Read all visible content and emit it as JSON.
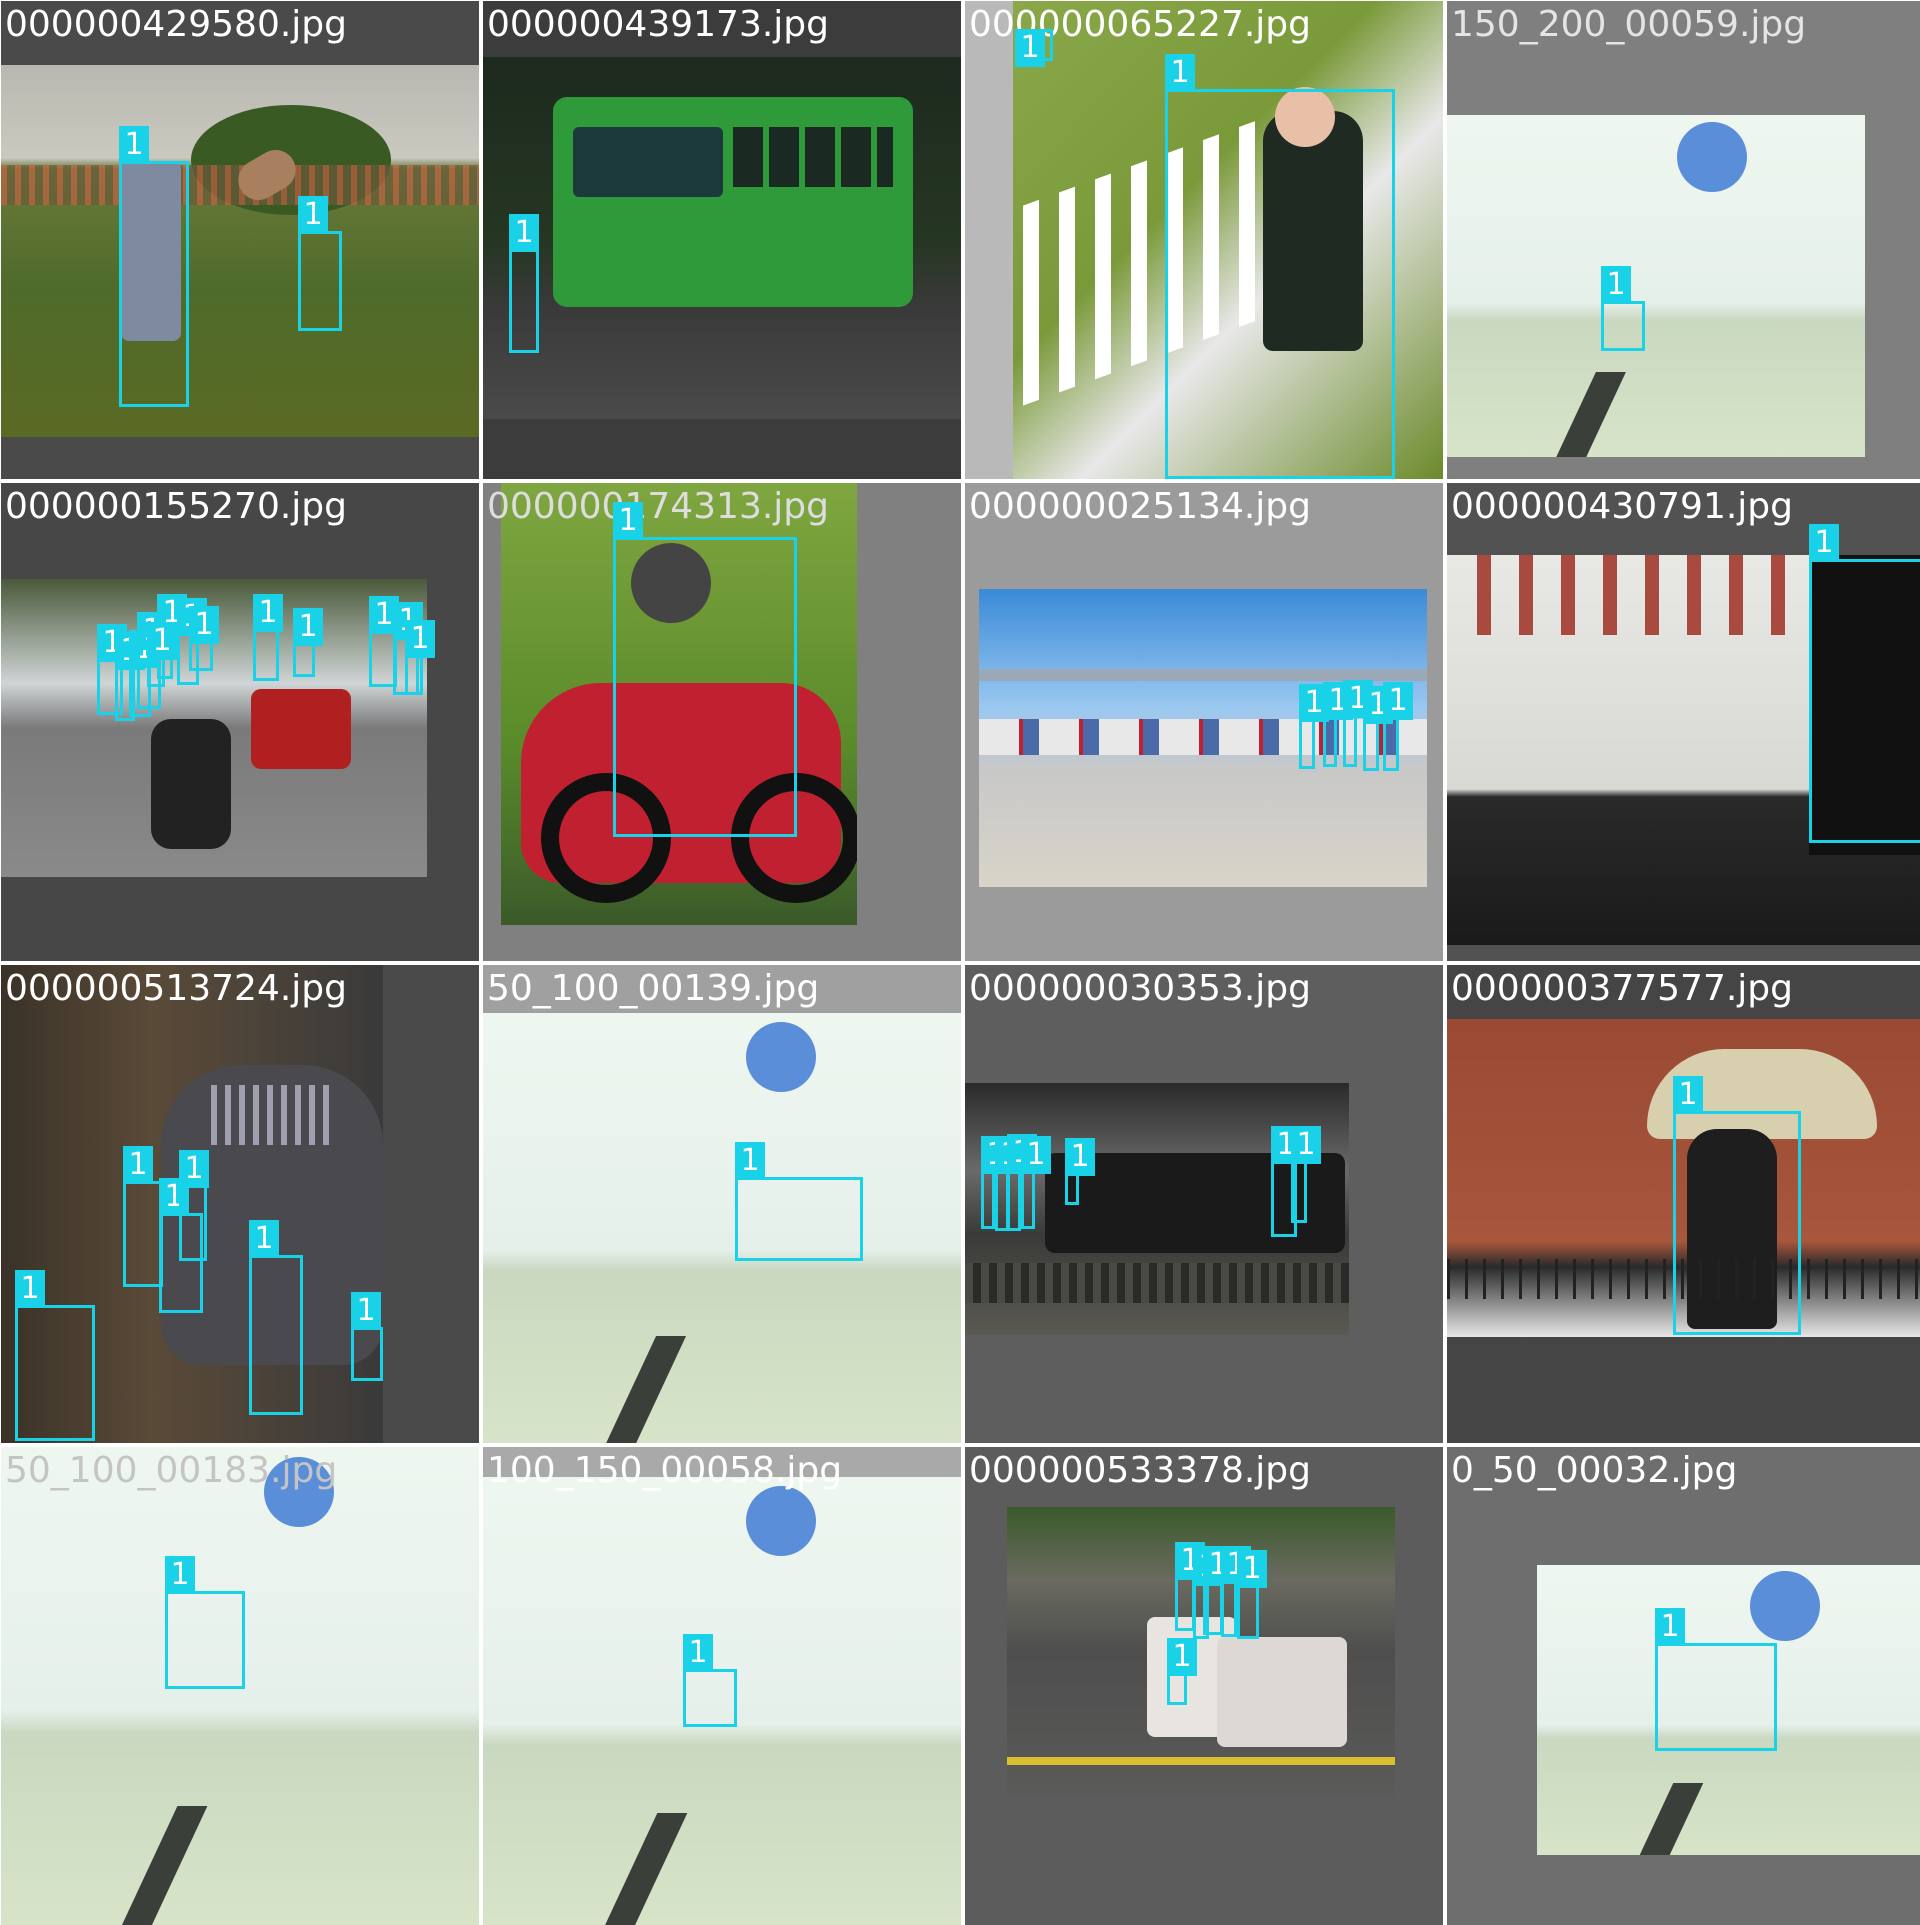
{
  "box_color": "#19d2e8",
  "label_text_color": "#ffffff",
  "images": [
    {
      "file": "000000429580.jpg",
      "boxes": [
        {
          "label": "1"
        },
        {
          "label": "1"
        }
      ]
    },
    {
      "file": "000000439173.jpg",
      "boxes": [
        {
          "label": "1"
        }
      ]
    },
    {
      "file": "000000065227.jpg",
      "boxes": [
        {
          "label": "1"
        },
        {
          "label": "1"
        }
      ]
    },
    {
      "file": "150_200_00059.jpg",
      "boxes": [
        {
          "label": "1"
        }
      ]
    },
    {
      "file": "000000155270.jpg",
      "boxes": [
        {
          "label": "1"
        },
        {
          "label": "1"
        },
        {
          "label": "1"
        },
        {
          "label": "1"
        },
        {
          "label": "1"
        },
        {
          "label": "1"
        },
        {
          "label": "1"
        },
        {
          "label": "1"
        },
        {
          "label": "1"
        },
        {
          "label": "1"
        },
        {
          "label": "1"
        },
        {
          "label": "1"
        },
        {
          "label": "1"
        }
      ]
    },
    {
      "file": "000000174313.jpg",
      "boxes": [
        {
          "label": "1"
        }
      ]
    },
    {
      "file": "000000025134.jpg",
      "boxes": [
        {
          "label": "1"
        },
        {
          "label": "1"
        },
        {
          "label": "1"
        },
        {
          "label": "1"
        },
        {
          "label": "1"
        }
      ]
    },
    {
      "file": "000000430791.jpg",
      "boxes": [
        {
          "label": "1"
        }
      ]
    },
    {
      "file": "000000513724.jpg",
      "boxes": [
        {
          "label": "1"
        },
        {
          "label": "1"
        },
        {
          "label": "1"
        },
        {
          "label": "1"
        },
        {
          "label": "1"
        },
        {
          "label": "1"
        }
      ]
    },
    {
      "file": "50_100_00139.jpg",
      "boxes": [
        {
          "label": "1"
        }
      ]
    },
    {
      "file": "000000030353.jpg",
      "boxes": [
        {
          "label": "1"
        },
        {
          "label": "1"
        },
        {
          "label": "1"
        },
        {
          "label": "1"
        },
        {
          "label": "1"
        },
        {
          "label": "1"
        },
        {
          "label": "1"
        }
      ]
    },
    {
      "file": "000000377577.jpg",
      "boxes": [
        {
          "label": "1"
        }
      ]
    },
    {
      "file": "50_100_00183.jpg",
      "boxes": [
        {
          "label": "1"
        }
      ]
    },
    {
      "file": "100_150_00058.jpg",
      "boxes": [
        {
          "label": "1"
        }
      ]
    },
    {
      "file": "000000533378.jpg",
      "boxes": [
        {
          "label": "1"
        },
        {
          "label": "1"
        },
        {
          "label": "1"
        },
        {
          "label": "1"
        },
        {
          "label": "1"
        },
        {
          "label": "1"
        }
      ]
    },
    {
      "file": "0_50_00032.jpg",
      "boxes": [
        {
          "label": "1"
        }
      ]
    }
  ]
}
